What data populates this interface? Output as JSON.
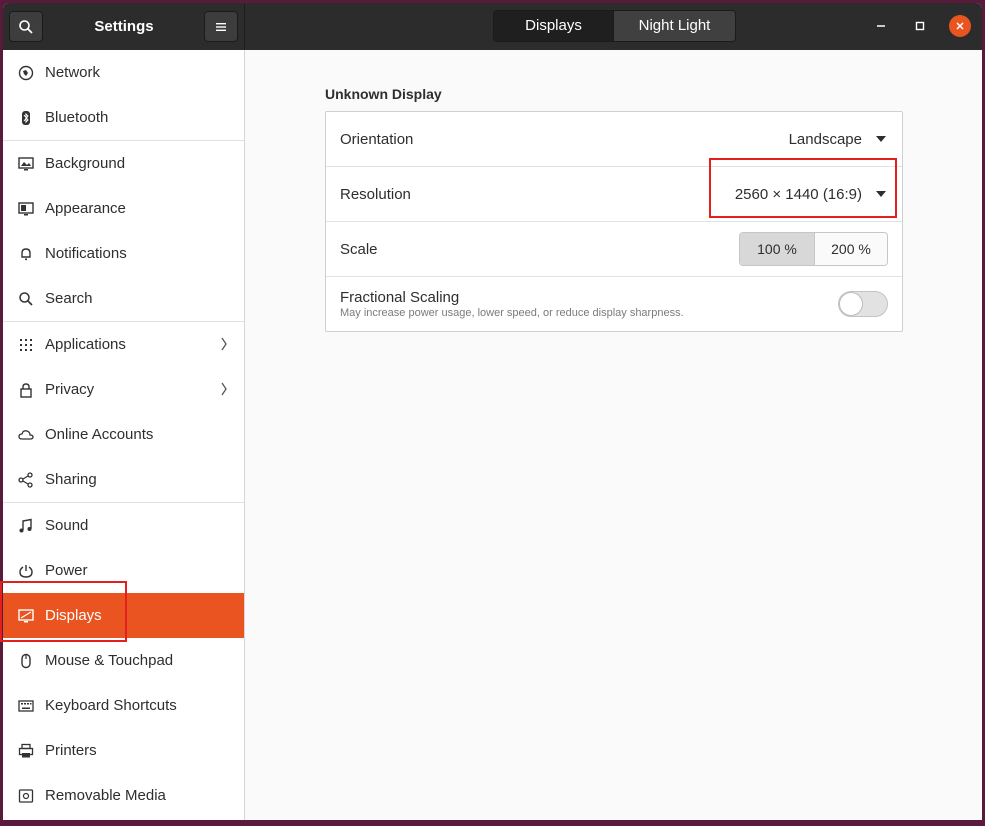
{
  "header": {
    "search_icon": "search-icon",
    "title": "Settings",
    "menu_icon": "hamburger-icon",
    "tabs": [
      {
        "label": "Displays",
        "active": true
      },
      {
        "label": "Night Light",
        "active": false
      }
    ]
  },
  "sidebar": {
    "items": [
      {
        "label": "Network",
        "icon": "network-icon"
      },
      {
        "label": "Bluetooth",
        "icon": "bluetooth-icon"
      },
      {
        "label": "Background",
        "icon": "background-icon"
      },
      {
        "label": "Appearance",
        "icon": "appearance-icon"
      },
      {
        "label": "Notifications",
        "icon": "bell-icon"
      },
      {
        "label": "Search",
        "icon": "search-icon"
      },
      {
        "label": "Applications",
        "icon": "grid-icon"
      },
      {
        "label": "Privacy",
        "icon": "lock-icon"
      },
      {
        "label": "Online Accounts",
        "icon": "cloud-icon"
      },
      {
        "label": "Sharing",
        "icon": "share-icon"
      },
      {
        "label": "Sound",
        "icon": "music-note-icon"
      },
      {
        "label": "Power",
        "icon": "power-icon"
      },
      {
        "label": "Displays",
        "icon": "display-icon"
      },
      {
        "label": "Mouse & Touchpad",
        "icon": "mouse-icon"
      },
      {
        "label": "Keyboard Shortcuts",
        "icon": "keyboard-icon"
      },
      {
        "label": "Printers",
        "icon": "printer-icon"
      },
      {
        "label": "Removable Media",
        "icon": "media-icon"
      }
    ]
  },
  "display": {
    "section_title": "Unknown Display",
    "orientation_label": "Orientation",
    "orientation_value": "Landscape",
    "resolution_label": "Resolution",
    "resolution_value": "2560 × 1440 (16:9)",
    "scale_label": "Scale",
    "scale_options": [
      "100 %",
      "200 %"
    ],
    "scale_selected": "100 %",
    "fractional_label": "Fractional Scaling",
    "fractional_desc": "May increase power usage, lower speed, or reduce display sharpness.",
    "fractional_enabled": false
  },
  "colors": {
    "accent": "#e95420",
    "highlight_annotation": "#e2201f"
  }
}
